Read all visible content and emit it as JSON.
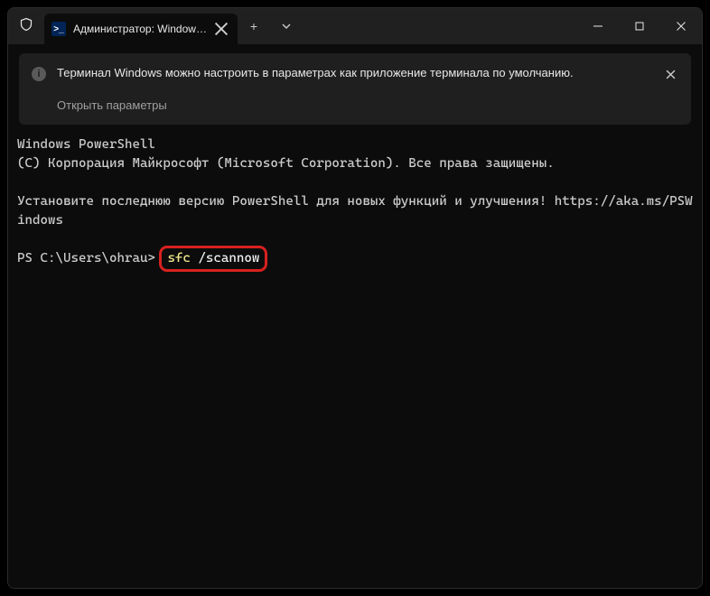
{
  "titlebar": {
    "tab_title": "Администратор: Windows Pc",
    "ps_icon_text": ">_",
    "newtab_glyph": "+"
  },
  "infobar": {
    "message": "Терминал Windows можно настроить в параметрах как приложение терминала по умолчанию.",
    "link": "Открыть параметры",
    "info_glyph": "i"
  },
  "terminal": {
    "line1": "Windows PowerShell",
    "line2": "(C) Корпорация Майкрософт (Microsoft Corporation). Все права защищены.",
    "line3": "Установите последнюю версию PowerShell для новых функций и улучшения! https://aka.ms/PSWindows",
    "prompt": "PS C:\\Users\\ohrau> ",
    "command_name": "sfc",
    "command_args": " /scannow"
  }
}
